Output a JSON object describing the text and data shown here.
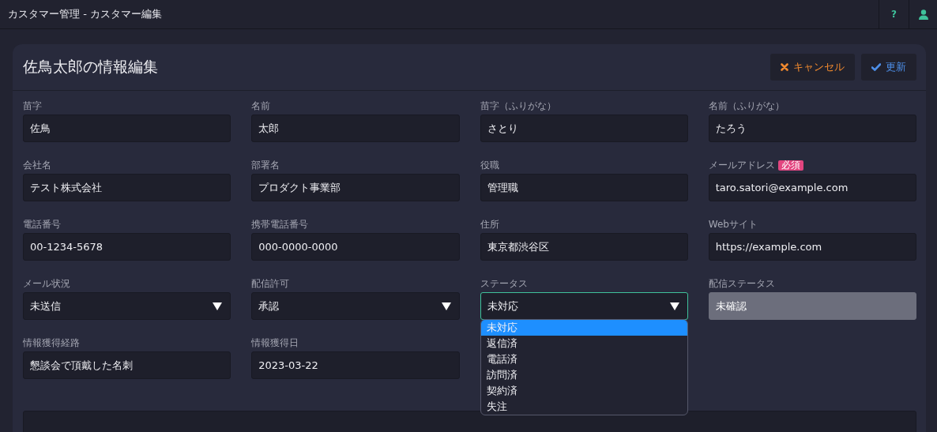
{
  "window": {
    "title": "カスタマー管理 - カスタマー編集"
  },
  "top_actions": [
    {
      "kind": "help",
      "label": "?"
    },
    {
      "kind": "user"
    }
  ],
  "card": {
    "title": "佐鳥太郎の情報編集",
    "buttons": [
      {
        "kind": "cancel",
        "label": "キャンセル"
      },
      {
        "kind": "save",
        "label": "更新"
      }
    ],
    "fields": [
      {
        "kind": "text",
        "label": "苗字",
        "value": "佐鳥"
      },
      {
        "kind": "text",
        "label": "名前",
        "value": "太郎"
      },
      {
        "kind": "text",
        "label": "苗字（ふりがな）",
        "value": "さとり"
      },
      {
        "kind": "text",
        "label": "名前（ふりがな）",
        "value": "たろう"
      },
      {
        "kind": "text",
        "label": "会社名",
        "value": "テスト株式会社"
      },
      {
        "kind": "text",
        "label": "部署名",
        "value": "プロダクト事業部"
      },
      {
        "kind": "text",
        "label": "役職",
        "value": "管理職"
      },
      {
        "kind": "text",
        "label": "メールアドレス",
        "value": "taro.satori@example.com",
        "badge": "必須"
      },
      {
        "kind": "text",
        "label": "電話番号",
        "value": "00-1234-5678"
      },
      {
        "kind": "text",
        "label": "携帯電話番号",
        "value": "000-0000-0000"
      },
      {
        "kind": "text",
        "label": "住所",
        "value": "東京都渋谷区"
      },
      {
        "kind": "text",
        "label": "Webサイト",
        "value": "https://example.com"
      },
      {
        "kind": "select",
        "label": "メール状況",
        "value": "未送信",
        "expanded": false
      },
      {
        "kind": "select",
        "label": "配信許可",
        "value": "承認",
        "expanded": false
      },
      {
        "kind": "select",
        "label": "ステータス",
        "value": "未対応",
        "expanded": true,
        "options": [
          {
            "label": "未対応",
            "selected": true
          },
          {
            "label": "返信済",
            "selected": false
          },
          {
            "label": "電話済",
            "selected": false
          },
          {
            "label": "訪問済",
            "selected": false
          },
          {
            "label": "契約済",
            "selected": false
          },
          {
            "label": "失注",
            "selected": false
          }
        ]
      },
      {
        "kind": "readonly",
        "label": "配信ステータス",
        "value": "未確認"
      },
      {
        "kind": "text",
        "label": "情報獲得経路",
        "value": "懇談会で頂戴した名刺"
      },
      {
        "kind": "text",
        "label": "情報獲得日",
        "value": "2023-03-22"
      }
    ]
  }
}
